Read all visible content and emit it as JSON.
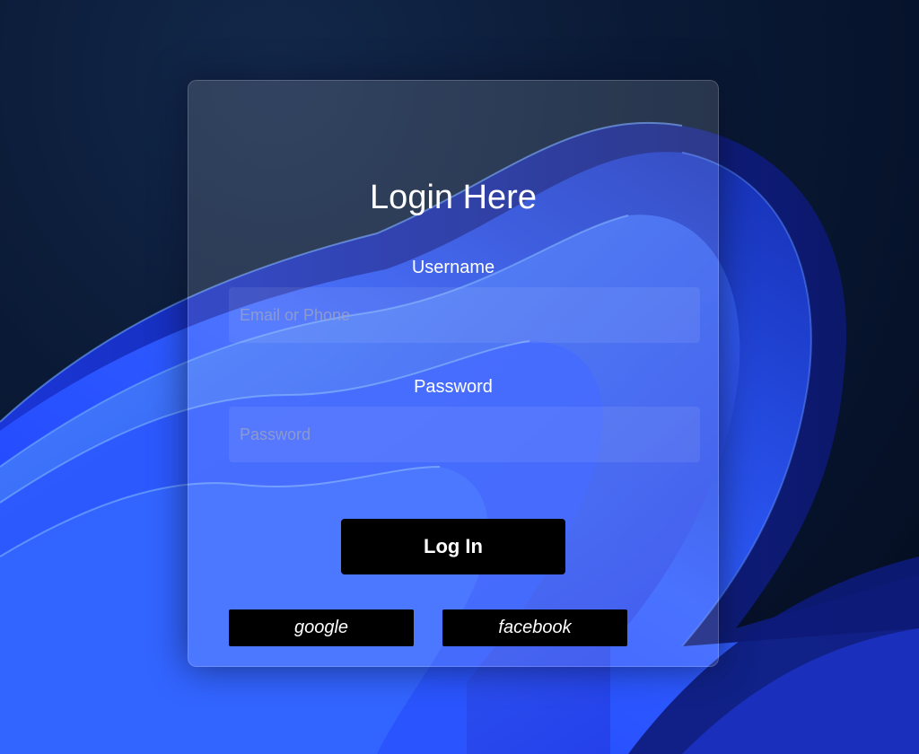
{
  "form": {
    "title": "Login Here",
    "username_label": "Username",
    "username_placeholder": "Email or Phone",
    "username_value": "",
    "password_label": "Password",
    "password_placeholder": "Password",
    "password_value": "",
    "login_button": "Log In",
    "google_button": "google",
    "facebook_button": "facebook"
  },
  "colors": {
    "background": "#06122a",
    "wave_primary": "#2f5bff",
    "button": "#000000",
    "text": "#ffffff"
  }
}
